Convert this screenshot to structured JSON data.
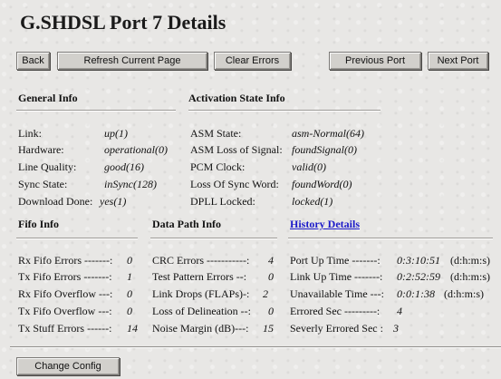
{
  "page": {
    "title": "G.SHDSL Port 7 Details"
  },
  "toolbar": {
    "back": "Back",
    "refresh": "Refresh Current Page",
    "clear_errors": "Clear Errors",
    "previous_port": "Previous Port",
    "next_port": "Next Port"
  },
  "general": {
    "heading": "General Info",
    "rows": [
      {
        "label": "Link:",
        "value": "up(1)"
      },
      {
        "label": "Hardware:",
        "value": "operational(0)"
      },
      {
        "label": "Line Quality:",
        "value": "good(16)"
      },
      {
        "label": "Sync State:",
        "value": "inSync(128)"
      },
      {
        "label": "Download Done:",
        "value": "yes(1)"
      }
    ]
  },
  "activation": {
    "heading": "Activation State Info",
    "rows": [
      {
        "label": "ASM State:",
        "value": "asm-Normal(64)"
      },
      {
        "label": "ASM Loss of Signal:",
        "value": "foundSignal(0)"
      },
      {
        "label": "PCM Clock:",
        "value": "valid(0)"
      },
      {
        "label": "Loss Of Sync Word:",
        "value": "foundWord(0)"
      },
      {
        "label": "DPLL Locked:",
        "value": "locked(1)"
      }
    ]
  },
  "fifo": {
    "heading": "Fifo Info",
    "rows": [
      {
        "label": "Rx Fifo Errors -------:",
        "value": "0"
      },
      {
        "label": "Tx Fifo Errors -------:",
        "value": "1"
      },
      {
        "label": "Rx Fifo Overflow ---:",
        "value": "0"
      },
      {
        "label": "Tx Fifo Overflow ---:",
        "value": "0"
      },
      {
        "label": "Tx Stuff Errors ------:",
        "value": "14"
      }
    ]
  },
  "datapath": {
    "heading": "Data Path Info",
    "rows": [
      {
        "label": "CRC Errors -----------:",
        "value": "4"
      },
      {
        "label": "Test Pattern Errors --:",
        "value": "0"
      },
      {
        "label": "Link Drops (FLAPs)-:",
        "value": "2"
      },
      {
        "label": "Loss of Delineation --:",
        "value": "0"
      },
      {
        "label": "Noise Margin (dB)---:",
        "value": "15"
      }
    ]
  },
  "history": {
    "link": "History Details",
    "rows": [
      {
        "label": "Port Up Time -------:",
        "value": "0:3:10:51",
        "unit": "(d:h:m:s)"
      },
      {
        "label": "Link Up Time -------:",
        "value": "0:2:52:59",
        "unit": "(d:h:m:s)"
      },
      {
        "label": "Unavailable Time ---:",
        "value": "0:0:1:38",
        "unit": "(d:h:m:s)"
      },
      {
        "label": "Errored Sec ---------:",
        "value": "4",
        "unit": ""
      },
      {
        "label": "Severly Errored Sec :",
        "value": "3",
        "unit": ""
      }
    ]
  },
  "footer": {
    "change_config": "Change Config"
  }
}
